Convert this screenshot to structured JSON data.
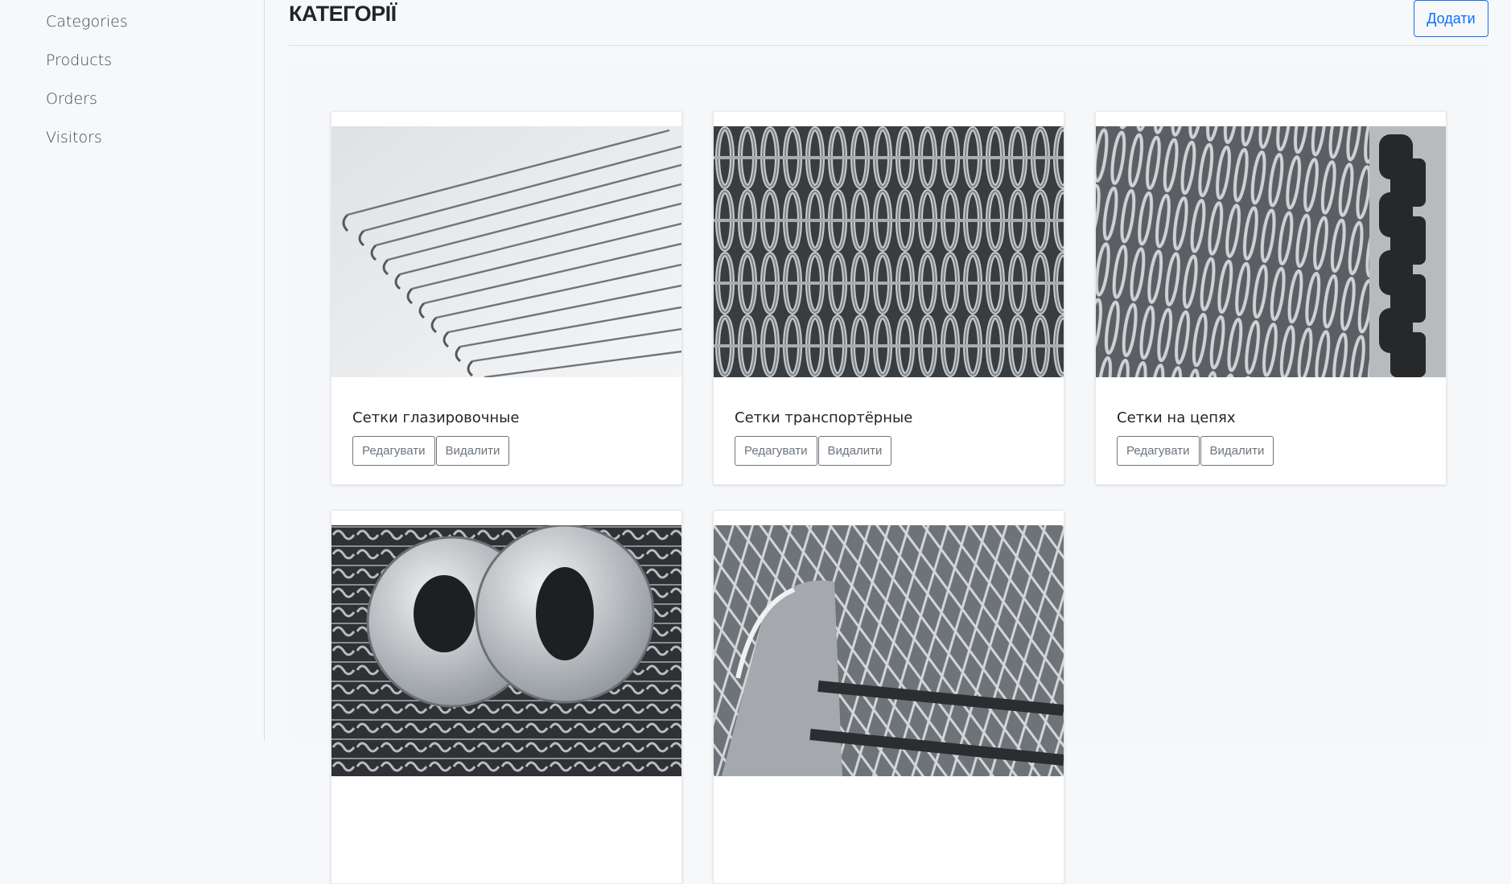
{
  "sidebar": {
    "items": [
      {
        "label": "Categories"
      },
      {
        "label": "Products"
      },
      {
        "label": "Orders"
      },
      {
        "label": "Visitors"
      }
    ]
  },
  "header": {
    "title": "КАТЕГОРІЇ",
    "add_label": "Додати"
  },
  "cards": [
    {
      "title": "Сетки глазировочные",
      "edit_label": "Редагувати",
      "delete_label": "Видалити"
    },
    {
      "title": "Сетки транспортёрные",
      "edit_label": "Редагувати",
      "delete_label": "Видалити"
    },
    {
      "title": "Сетки на цепях",
      "edit_label": "Редагувати",
      "delete_label": "Видалити"
    },
    {
      "title": "",
      "edit_label": "",
      "delete_label": ""
    },
    {
      "title": "",
      "edit_label": "",
      "delete_label": ""
    }
  ],
  "colors": {
    "primary": "#0d6efd",
    "secondary": "#6c757d",
    "background": "#f6f8fa"
  }
}
